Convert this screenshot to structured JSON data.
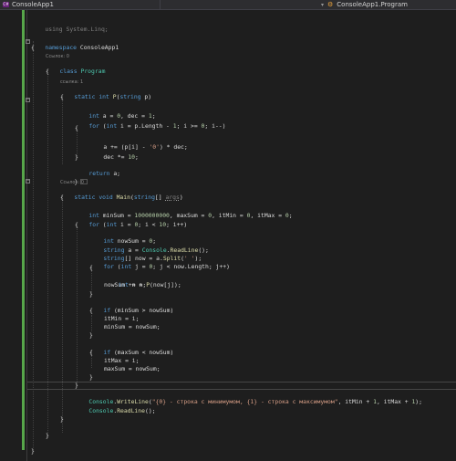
{
  "tabs": {
    "project": "ConsoleApp1",
    "class_path": "ConsoleApp1.Program"
  },
  "code_lens": {
    "namespace_refs": "Ссылок: 0",
    "p_refs": "ссылка: 1",
    "main_refs": "Ссылок: 0"
  },
  "code": {
    "l1a": "using",
    "l1b": " System.Linq;",
    "l2a": "namespace",
    "l2b": " ConsoleApp1",
    "l3": "{",
    "l4a": "class",
    "l4b": " Program",
    "l5": "{",
    "l6a": "static int",
    "l6b": " P",
    "l6c": "(",
    "l6d": "string",
    "l6e": " p)",
    "l7": "{",
    "l8a": "int",
    "l8b": " a = ",
    "l8c": "0",
    "l8d": ", dec = ",
    "l8e": "1",
    "l8f": ";",
    "l9a": "for",
    "l9b": " (",
    "l9c": "int",
    "l9d": " i = p.Length - ",
    "l9e": "1",
    "l9f": "; i >= ",
    "l9g": "0",
    "l9h": "; i--)",
    "l10": "{",
    "l11a": "a += (p[i] - ",
    "l11b": "'0'",
    "l11c": ") * dec;",
    "l12a": "dec *= ",
    "l12b": "10",
    "l12c": ";",
    "l13": "}",
    "l14a": "return",
    "l14b": " a;",
    "l15": "}",
    "l16a": "static void",
    "l16b": " Main",
    "l16c": "(",
    "l16d": "string",
    "l16e": "[] ",
    "l16f": "args",
    "l16g": ")",
    "l17": "{",
    "l18a": "int",
    "l18b": " minSum = ",
    "l18c": "1000000000",
    "l18d": ", maxSum = ",
    "l18e": "0",
    "l18f": ", itMin = ",
    "l18g": "0",
    "l18h": ", itMax = ",
    "l18i": "0",
    "l18j": ";",
    "l19a": "for",
    "l19b": " (",
    "l19c": "int",
    "l19d": " i = ",
    "l19e": "0",
    "l19f": "; i < ",
    "l19g": "10",
    "l19h": "; i++)",
    "l20": "{",
    "l21a": "int",
    "l21b": " nowSum = ",
    "l21c": "0",
    "l21d": ";",
    "l22a": "string",
    "l22b": " a = ",
    "l22c": "Console",
    "l22d": ".",
    "l22e": "ReadLine",
    "l22f": "();",
    "l23a": "string",
    "l23b": "[] now = a.",
    "l23c": "Split",
    "l23d": "(",
    "l23e": "' '",
    "l23f": ");",
    "l24a": "for",
    "l24b": " (",
    "l24c": "int",
    "l24d": " j = ",
    "l24e": "0",
    "l24f": "; j < now.Length; j++)",
    "l25": "{",
    "l26a": "int",
    "l26b": " n = ",
    "l26c": "P",
    "l26d": "(now[j]);",
    "l27": "nowSum += n;",
    "l28": "}",
    "l29a": "if",
    "l29b": " (minSum > nowSum)",
    "l30": "{",
    "l31": "itMin = i;",
    "l32": "minSum = nowSum;",
    "l33": "}",
    "l34a": "if",
    "l34b": " (maxSum < nowSum)",
    "l35": "{",
    "l36": "itMax = i;",
    "l37": "maxSum = nowSum;",
    "l38": "}",
    "l39": "}",
    "l40a": "Console",
    "l40b": ".",
    "l40c": "WriteLine",
    "l40d": "(",
    "l40e": "\"{0} - строка с минимумом, {1} - строка с максимумом\"",
    "l40f": ", itMin + ",
    "l40g": "1",
    "l40h": ", itMax + ",
    "l40i": "1",
    "l40j": ");",
    "l41a": "Console",
    "l41b": ".",
    "l41c": "ReadLine",
    "l41d": "();",
    "l42": "}",
    "l43": "}",
    "l44": "}"
  }
}
